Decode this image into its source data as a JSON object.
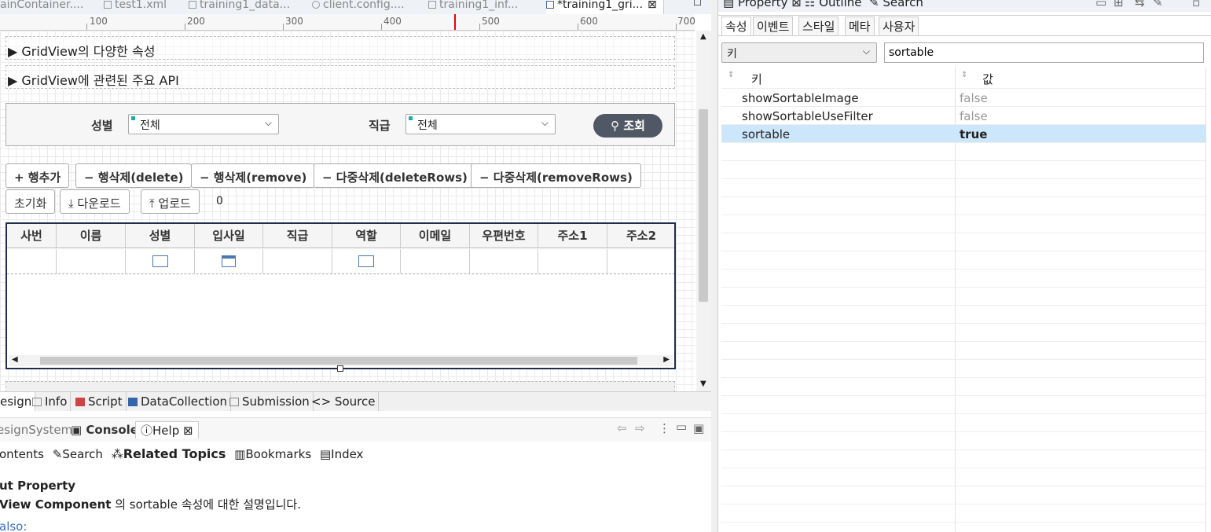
{
  "editor_tabs": [
    {
      "label": "ainContainer....",
      "active": false
    },
    {
      "label": "test1.xml",
      "active": false
    },
    {
      "label": "training1_data...",
      "active": false
    },
    {
      "label": "client.config....",
      "active": false
    },
    {
      "label": "training1_inf...",
      "active": false
    },
    {
      "label": "*training1_gri...",
      "active": true
    }
  ],
  "ruler": {
    "ticks": [
      "100",
      "200",
      "300",
      "400",
      "500",
      "600",
      "700"
    ]
  },
  "sections": [
    {
      "label": "▶ GridView의 다양한 속성"
    },
    {
      "label": "▶ GridView에 관련된 주요 API"
    }
  ],
  "filter": {
    "gender_label": "성별",
    "gender_value": "전체",
    "position_label": "직급",
    "position_value": "전체",
    "search_button": "조회"
  },
  "buttons_row1": [
    "+ 행추가",
    "− 행삭제(delete)",
    "− 행삭제(remove)",
    "− 다중삭제(deleteRows)",
    "− 다중삭제(removeRows)"
  ],
  "buttons_row2": [
    "초기화",
    "⤓ 다운로드",
    "⤒ 업로드"
  ],
  "count_value": "0",
  "grid": {
    "columns": [
      "사번",
      "이름",
      "성별",
      "입사일",
      "직급",
      "역할",
      "이메일",
      "우편번호",
      "주소1",
      "주소2"
    ]
  },
  "bottom_tabs": [
    "esign",
    "Info",
    "Script",
    "DataCollection",
    "Submission",
    "Source"
  ],
  "view_tabs": [
    {
      "label": "esignSystem",
      "active": false
    },
    {
      "label": "Console",
      "active": false
    },
    {
      "label": "Help",
      "active": true
    }
  ],
  "help": {
    "nav": [
      "ontents",
      "Search",
      "Related Topics",
      "Bookmarks",
      "Index"
    ],
    "heading": "ut Property",
    "desc_bold": "View Component",
    "desc_rest": " 의 sortable 속성에 대한 설명입니다.",
    "see_also": "also:"
  },
  "right_tabs": [
    "Property",
    "Outline",
    "Search"
  ],
  "property": {
    "subtabs": [
      "속성",
      "이벤트",
      "스타일",
      "메타",
      "사용자"
    ],
    "filter_key": "키",
    "filter_value": "sortable",
    "col_key": "키",
    "col_value": "값",
    "rows": [
      {
        "key": "showSortableImage",
        "value": "false",
        "selected": false
      },
      {
        "key": "showSortableUseFilter",
        "value": "false",
        "selected": false
      },
      {
        "key": "sortable",
        "value": "true",
        "selected": true
      }
    ]
  },
  "colors": {
    "accent_selection": "#cce6fb",
    "search_button": "#4f5864",
    "grid_border": "#1e2e4a"
  }
}
